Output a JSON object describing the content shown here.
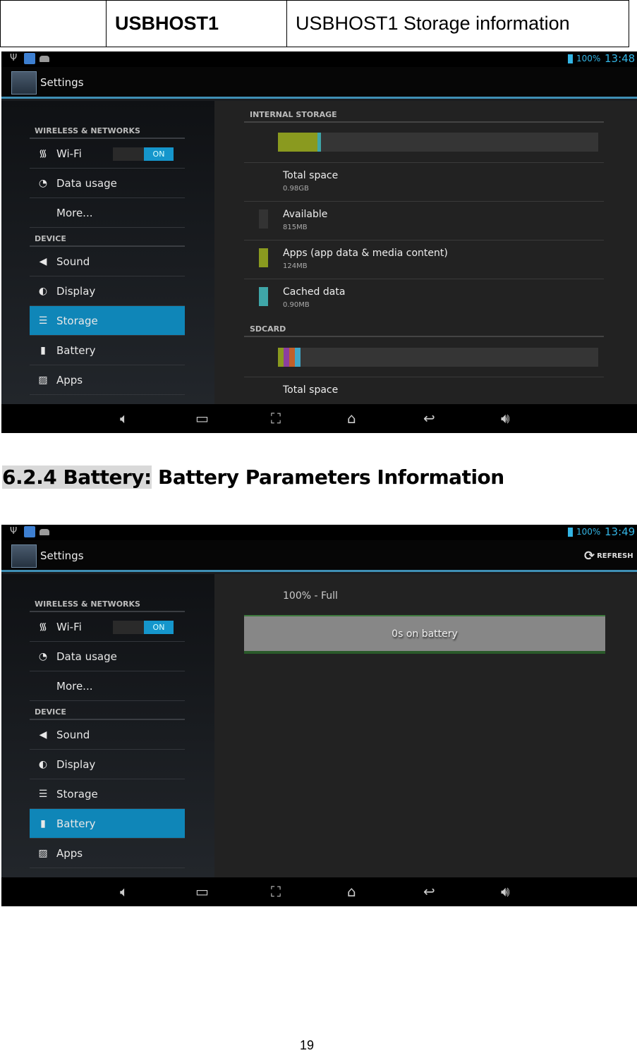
{
  "header_table": {
    "col1": "",
    "col2": "USBHOST1",
    "col3": "USBHOST1 Storage information"
  },
  "section_heading": {
    "number_label": "6.2.4 Battery:",
    "rest": " Battery Parameters Information"
  },
  "page_number": "19",
  "colors": {
    "accent": "#0f86b8",
    "apps": "#8a9a1f",
    "cached": "#3fa6a8",
    "available": "#353535"
  },
  "screen1": {
    "status": {
      "battery": "100%",
      "time": "13:48"
    },
    "title": "Settings",
    "sidebar": {
      "sections": [
        "WIRELESS & NETWORKS",
        "DEVICE"
      ],
      "wifi_toggle": "ON",
      "selected": "Storage"
    },
    "storage": {
      "internal_header": "INTERNAL STORAGE",
      "usage_bar": {
        "apps_fraction": 0.123,
        "cached_fraction": 0.011
      },
      "rows": [
        {
          "label": "Total space",
          "value": "0.98GB"
        },
        {
          "label": "Available",
          "value": "815MB"
        },
        {
          "label": "Apps (app data & media content)",
          "value": "124MB"
        },
        {
          "label": "Cached data",
          "value": "0.90MB"
        }
      ],
      "sdcard_header": "SDCARD",
      "sd_total_label": "Total space"
    }
  },
  "screen2": {
    "status": {
      "battery": "100%",
      "time": "13:49"
    },
    "title": "Settings",
    "refresh_label": "REFRESH",
    "sidebar": {
      "sections": [
        "WIRELESS & NETWORKS",
        "DEVICE"
      ],
      "wifi_toggle": "ON",
      "selected": "Battery"
    },
    "battery": {
      "level_text": "100% - Full",
      "graph_text": "0s on battery",
      "level_percent": 100
    }
  },
  "sidebar_items": [
    {
      "label": "Wi-Fi",
      "icon": "wifi-icon"
    },
    {
      "label": "Data usage",
      "icon": "data-usage-icon"
    },
    {
      "label": "More...",
      "icon": ""
    },
    {
      "label": "Sound",
      "icon": "sound-icon"
    },
    {
      "label": "Display",
      "icon": "display-icon"
    },
    {
      "label": "Storage",
      "icon": "storage-icon"
    },
    {
      "label": "Battery",
      "icon": "battery-icon"
    },
    {
      "label": "Apps",
      "icon": "apps-icon"
    }
  ]
}
